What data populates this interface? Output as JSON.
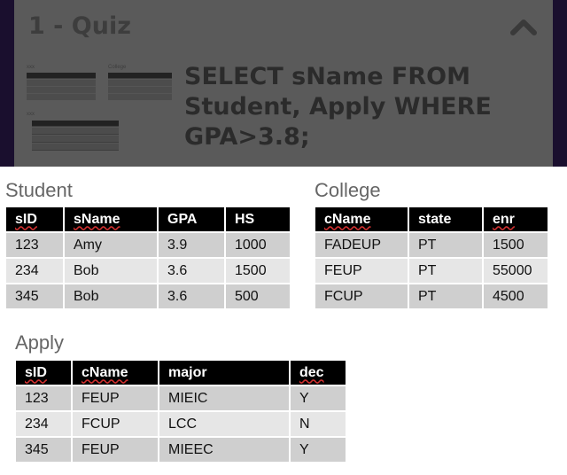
{
  "quiz": {
    "title": "1 - Quiz",
    "question": "SELECT sName FROM Student, Apply WHERE GPA>3.8;",
    "thumb_labels": [
      "xxx",
      "College",
      "xxx"
    ]
  },
  "student": {
    "label": "Student",
    "headers": [
      "sID",
      "sName",
      "GPA",
      "HS"
    ],
    "rows": [
      [
        "123",
        "Amy",
        "3.9",
        "1000"
      ],
      [
        "234",
        "Bob",
        "3.6",
        "1500"
      ],
      [
        "345",
        "Bob",
        "3.6",
        "500"
      ]
    ]
  },
  "college": {
    "label": "College",
    "headers": [
      "cName",
      "state",
      "enr"
    ],
    "rows": [
      [
        "FADEUP",
        "PT",
        "1500"
      ],
      [
        "FEUP",
        "PT",
        "55000"
      ],
      [
        "FCUP",
        "PT",
        "4500"
      ]
    ]
  },
  "apply": {
    "label": "Apply",
    "headers": [
      "sID",
      "cName",
      "major",
      "dec"
    ],
    "rows": [
      [
        "123",
        "FEUP",
        "MIEIC",
        "Y"
      ],
      [
        "234",
        "FCUP",
        "LCC",
        "N"
      ],
      [
        "345",
        "FEUP",
        "MIEEC",
        "Y"
      ]
    ]
  },
  "icons": {
    "collapse": "chevron-up-icon"
  }
}
